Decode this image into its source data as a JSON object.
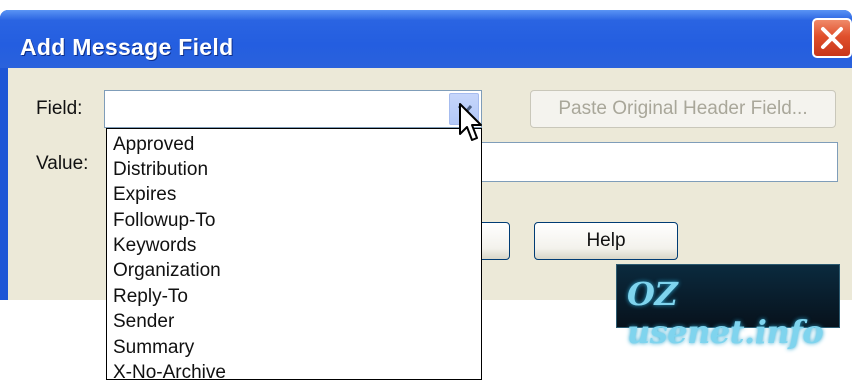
{
  "window": {
    "title": "Add Message Field"
  },
  "form": {
    "field_label": "Field:",
    "value_label": "Value:",
    "field_value": "",
    "value_value": ""
  },
  "buttons": {
    "paste_label": "Paste Original Header Field...",
    "help_label": "Help",
    "ok_label": ""
  },
  "dropdown": {
    "options": [
      "Approved",
      "Distribution",
      "Expires",
      "Followup-To",
      "Keywords",
      "Organization",
      "Reply-To",
      "Sender",
      "Summary",
      "X-No-Archive"
    ]
  },
  "watermark": {
    "text": "OZ usenet.info"
  },
  "colors": {
    "titlebar": "#245ee0",
    "close": "#e0502c",
    "dialog_bg": "#ece9d8",
    "watermark_text": "#7fd4ee"
  }
}
